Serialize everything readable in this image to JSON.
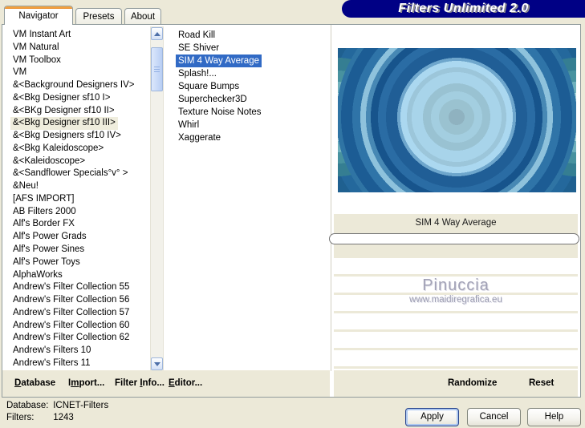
{
  "window": {
    "banner": "Filters Unlimited 2.0"
  },
  "tabs": [
    {
      "label": "Navigator",
      "active": true
    },
    {
      "label": "Presets",
      "active": false
    },
    {
      "label": "About",
      "active": false
    }
  ],
  "category_list": {
    "items": [
      "VM Instant Art",
      "VM Natural",
      "VM Toolbox",
      "VM",
      "&<Background Designers IV>",
      "&<Bkg Designer sf10 I>",
      "&<BKg Designer sf10 II>",
      "&<Bkg Designer sf10 III>",
      "&<Bkg Designers sf10 IV>",
      "&<Bkg Kaleidoscope>",
      "&<Kaleidoscope>",
      "&<Sandflower Specials°v° >",
      "&Neu!",
      "[AFS IMPORT]",
      "AB Filters 2000",
      "Alf's Border FX",
      "Alf's Power Grads",
      "Alf's Power Sines",
      "Alf's Power Toys",
      "AlphaWorks",
      "Andrew's Filter Collection 55",
      "Andrew's Filter Collection 56",
      "Andrew's Filter Collection 57",
      "Andrew's Filter Collection 60",
      "Andrew's Filter Collection 62",
      "Andrew's Filters 10",
      "Andrew's Filters 11"
    ],
    "selected": "&<Bkg Designer sf10 III>"
  },
  "filter_list": {
    "items": [
      "Road Kill",
      "SE Shiver",
      "SIM 4 Way Average",
      "Splash!...",
      "Square Bumps",
      "Superchecker3D",
      "Texture Noise Notes",
      "Whirl",
      "Xaggerate"
    ],
    "selected": "SIM 4 Way Average"
  },
  "preview": {
    "filter_name": "SIM 4 Way Average",
    "watermark_title": "Pinuccia",
    "watermark_url": "www.maidiregrafica.eu"
  },
  "toolbar": {
    "database": {
      "pre": "",
      "mn": "D",
      "post": "atabase"
    },
    "import": {
      "pre": "I",
      "mn": "m",
      "post": "port..."
    },
    "filter_info": {
      "pre": "Filter ",
      "mn": "I",
      "post": "nfo..."
    },
    "editor": {
      "pre": "",
      "mn": "E",
      "post": "ditor..."
    },
    "randomize": "Randomize",
    "reset": "Reset"
  },
  "status": {
    "database_label": "Database:",
    "database_value": "ICNET-Filters",
    "filters_label": "Filters:",
    "filters_value": "1243"
  },
  "buttons": {
    "apply": "Apply",
    "cancel": "Cancel",
    "help": "Help"
  },
  "colors": {
    "bg_beige": "#ECE9D8",
    "selection_blue": "#316AC5",
    "highlight_beige": "#EFEDDD",
    "banner_navy": "#000085",
    "tab_orange": "#E68B2C"
  }
}
